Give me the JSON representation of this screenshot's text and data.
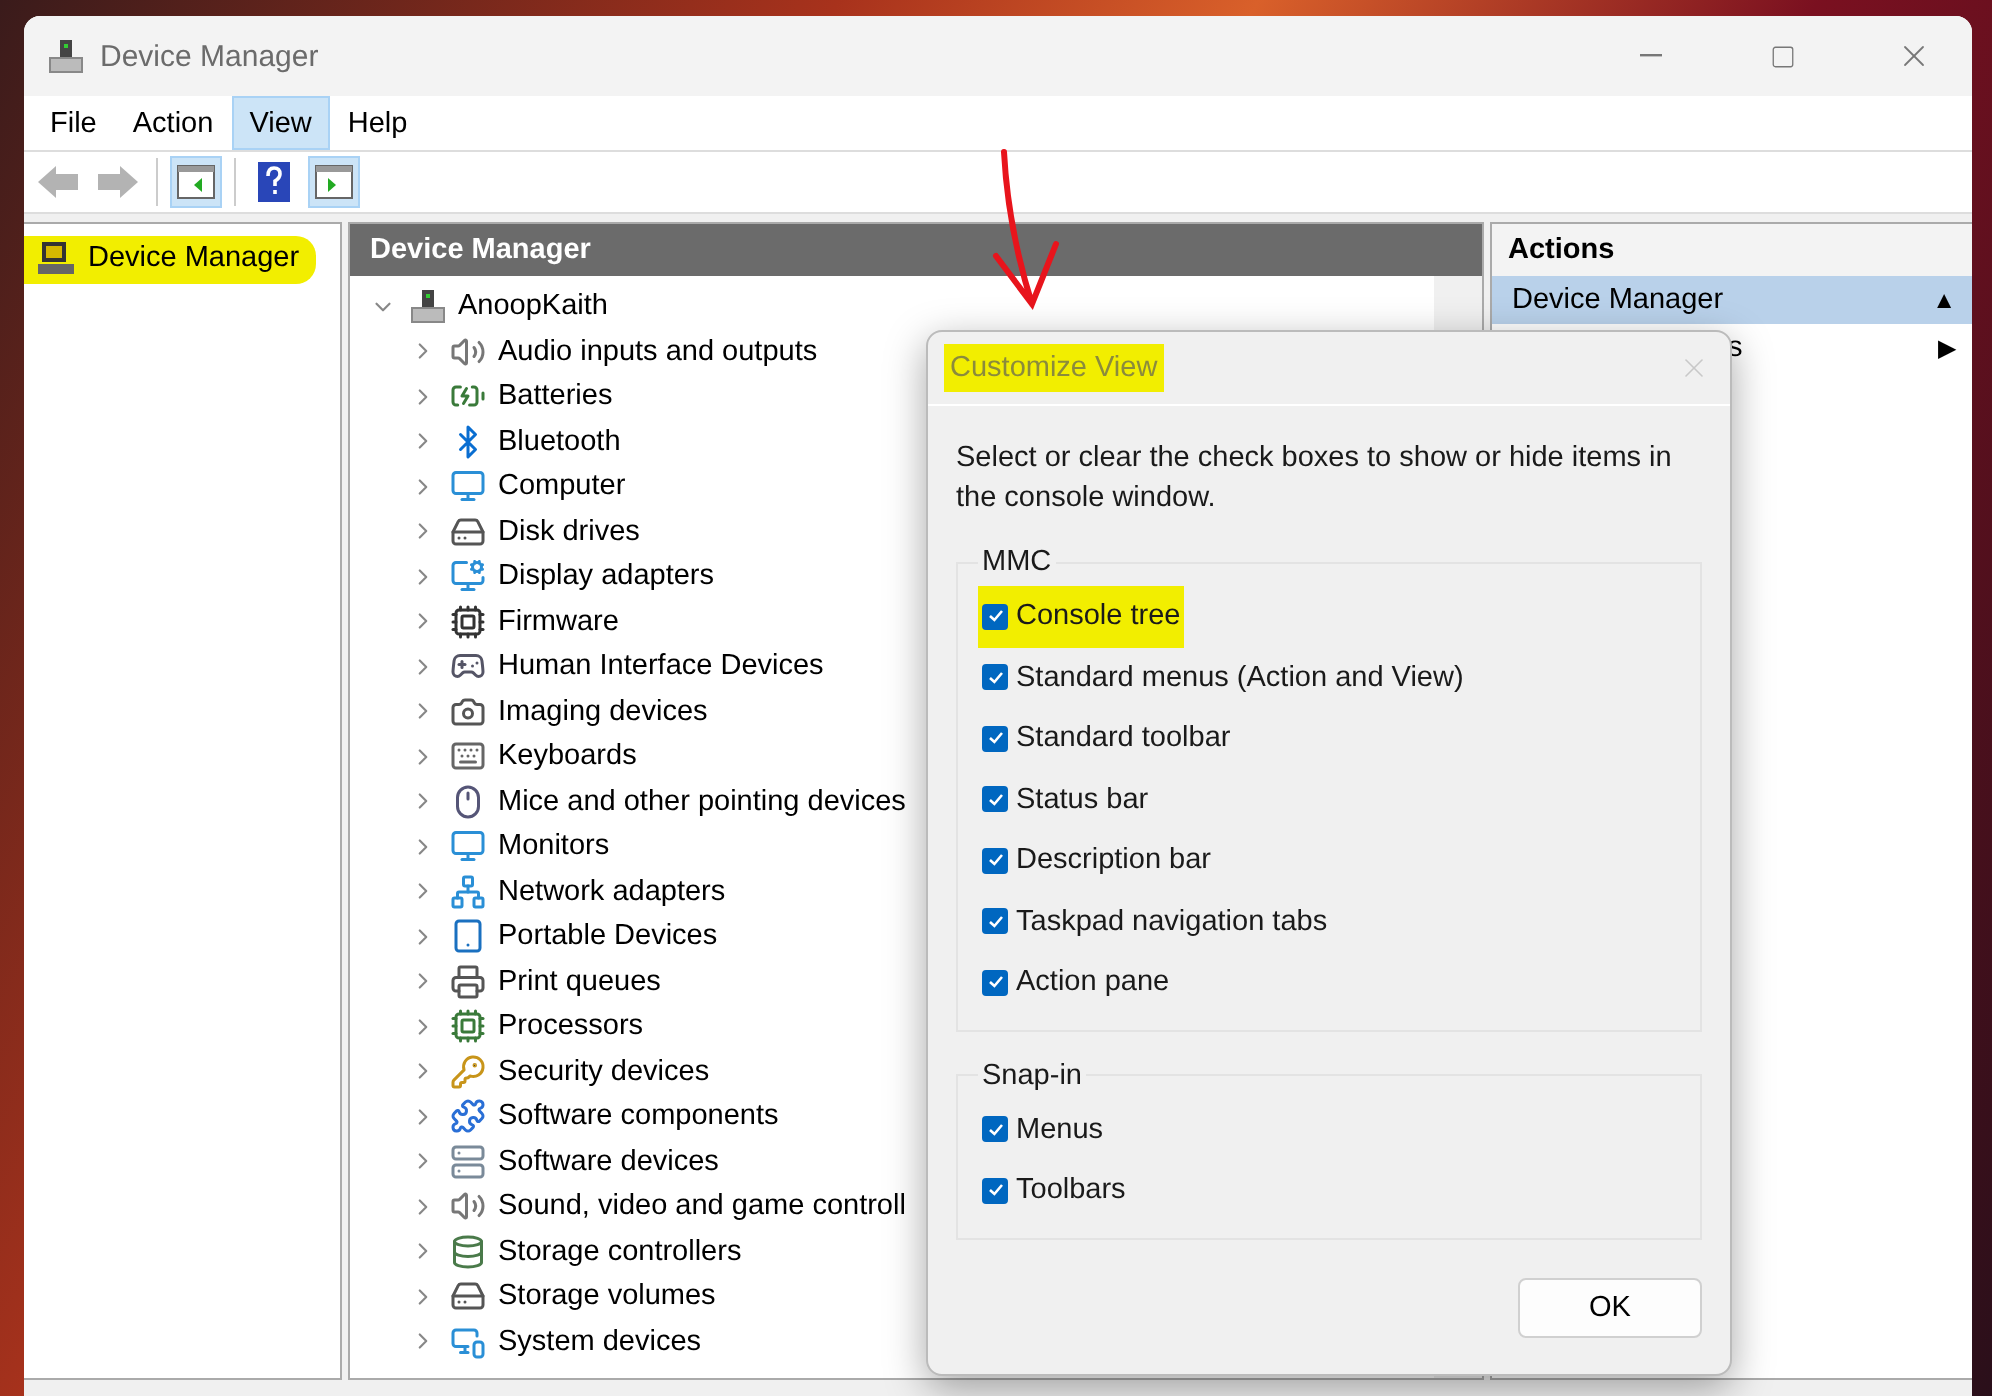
{
  "window": {
    "title": "Device Manager"
  },
  "menu": [
    {
      "label": "File",
      "selected": false
    },
    {
      "label": "Action",
      "selected": false
    },
    {
      "label": "View",
      "selected": true
    },
    {
      "label": "Help",
      "selected": false
    }
  ],
  "toolbar": [
    {
      "kind": "back",
      "disabled": true,
      "pressed": false
    },
    {
      "kind": "forward",
      "disabled": true,
      "pressed": false
    },
    {
      "kind": "console-tree",
      "disabled": false,
      "pressed": true
    },
    {
      "kind": "help",
      "disabled": false,
      "pressed": false
    },
    {
      "kind": "action-pane",
      "disabled": false,
      "pressed": true
    }
  ],
  "console_tree": {
    "items": [
      {
        "label": "Device Manager",
        "highlighted": true
      }
    ]
  },
  "content": {
    "header": "Device Manager",
    "tree": {
      "label": "AnoopKaith",
      "expanded": true,
      "children": [
        {
          "label": "Audio inputs and outputs",
          "expanded": false
        },
        {
          "label": "Batteries",
          "expanded": false
        },
        {
          "label": "Bluetooth",
          "expanded": false
        },
        {
          "label": "Computer",
          "expanded": false
        },
        {
          "label": "Disk drives",
          "expanded": false
        },
        {
          "label": "Display adapters",
          "expanded": false
        },
        {
          "label": "Firmware",
          "expanded": false
        },
        {
          "label": "Human Interface Devices",
          "expanded": false
        },
        {
          "label": "Imaging devices",
          "expanded": false
        },
        {
          "label": "Keyboards",
          "expanded": false
        },
        {
          "label": "Mice and other pointing devices",
          "expanded": false
        },
        {
          "label": "Monitors",
          "expanded": false
        },
        {
          "label": "Network adapters",
          "expanded": false
        },
        {
          "label": "Portable Devices",
          "expanded": false
        },
        {
          "label": "Print queues",
          "expanded": false
        },
        {
          "label": "Processors",
          "expanded": false
        },
        {
          "label": "Security devices",
          "expanded": false
        },
        {
          "label": "Software components",
          "expanded": false
        },
        {
          "label": "Software devices",
          "expanded": false
        },
        {
          "label": "Sound, video and game controll",
          "expanded": false
        },
        {
          "label": "Storage controllers",
          "expanded": false
        },
        {
          "label": "Storage volumes",
          "expanded": false
        },
        {
          "label": "System devices",
          "expanded": false
        }
      ]
    }
  },
  "actions": {
    "header": "Actions",
    "items": [
      {
        "label": "Device Manager",
        "selected": true,
        "arrow": "▲"
      },
      {
        "label": "s",
        "selected": false,
        "arrow": "▶"
      }
    ]
  },
  "dialog": {
    "title": "Customize View",
    "title_highlighted": true,
    "description": "Select or clear the check boxes to show or hide items in the console window.",
    "groups": [
      {
        "title": "MMC",
        "items": [
          {
            "label": "Console tree",
            "checked": true,
            "highlighted": true
          },
          {
            "label": "Standard menus (Action and View)",
            "checked": true,
            "highlighted": false
          },
          {
            "label": "Standard toolbar",
            "checked": true,
            "highlighted": false
          },
          {
            "label": "Status bar",
            "checked": true,
            "highlighted": false
          },
          {
            "label": "Description bar",
            "checked": true,
            "highlighted": false
          },
          {
            "label": "Taskpad navigation tabs",
            "checked": true,
            "highlighted": false
          },
          {
            "label": "Action pane",
            "checked": true,
            "highlighted": false
          }
        ]
      },
      {
        "title": "Snap-in",
        "items": [
          {
            "label": "Menus",
            "checked": true,
            "highlighted": false
          },
          {
            "label": "Toolbars",
            "checked": true,
            "highlighted": false
          }
        ]
      }
    ],
    "button": "OK"
  }
}
